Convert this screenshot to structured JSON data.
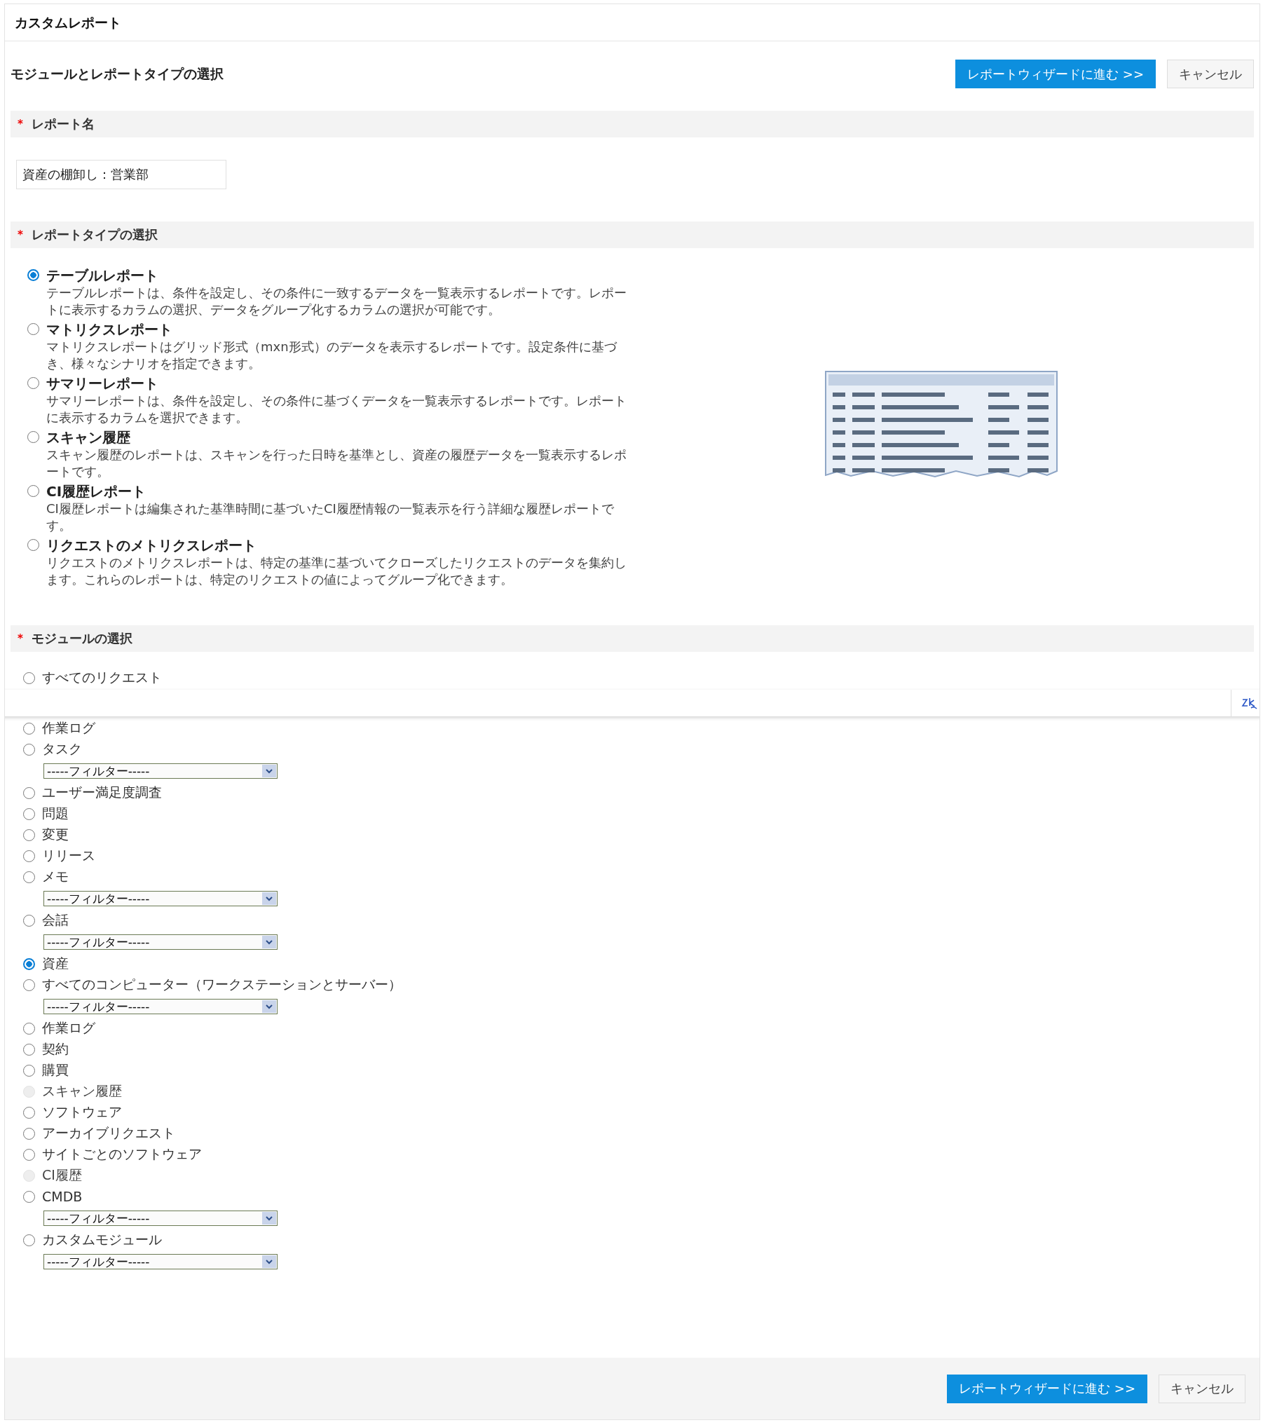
{
  "page_title": "カスタムレポート",
  "heading": "モジュールとレポートタイプの選択",
  "actions": [
    {
      "kind": "primary",
      "label": "レポートウィザードに進む >>"
    },
    {
      "kind": "secondary",
      "label": "キャンセル"
    }
  ],
  "report_name": {
    "label": "レポート名",
    "required_mark": "*",
    "value": "資産の棚卸し：営業部"
  },
  "report_types": {
    "label": "レポートタイプの選択",
    "required_mark": "*",
    "items": [
      {
        "title": "テーブルレポート",
        "description": "テーブルレポートは、条件を設定し、その条件に一致するデータを一覧表示するレポートです。レポートに表示するカラムの選択、データをグループ化するカラムの選択が可能です。",
        "selected": true
      },
      {
        "title": "マトリクスレポート",
        "description": "マトリクスレポートはグリッド形式（mxn形式）のデータを表示するレポートです。設定条件に基づき、様々なシナリオを指定できます。",
        "selected": false
      },
      {
        "title": "サマリーレポート",
        "description": "サマリーレポートは、条件を設定し、その条件に基づくデータを一覧表示するレポートです。レポートに表示するカラムを選択できます。",
        "selected": false
      },
      {
        "title": "スキャン履歴",
        "description": "スキャン履歴のレポートは、スキャンを行った日時を基準とし、資産の履歴データを一覧表示するレポートです。",
        "selected": false
      },
      {
        "title": "CI履歴レポート",
        "description": "CI履歴レポートは編集された基準時間に基づいたCI履歴情報の一覧表示を行う詳細な履歴レポートです。",
        "selected": false
      },
      {
        "title": "リクエストのメトリクスレポート",
        "description": "リクエストのメトリクスレポートは、特定の基準に基づいてクローズしたリクエストのデータを集約します。これらのレポートは、特定のリクエストの値によってグループ化できます。",
        "selected": false
      }
    ]
  },
  "modules": {
    "label": "モジュールの選択",
    "required_mark": "*",
    "items": [
      {
        "label": "すべてのリクエスト",
        "selected": false,
        "disabled": false,
        "kind": "plain"
      },
      {
        "label": "作業ログ",
        "selected": false,
        "disabled": false,
        "kind": "plain"
      },
      {
        "label": "タスク",
        "selected": false,
        "disabled": false,
        "kind": "filtered",
        "filter": "-----フィルター-----"
      },
      {
        "label": "ユーザー満足度調査",
        "selected": false,
        "disabled": false,
        "kind": "plain"
      },
      {
        "label": "問題",
        "selected": false,
        "disabled": false,
        "kind": "plain"
      },
      {
        "label": "変更",
        "selected": false,
        "disabled": false,
        "kind": "plain"
      },
      {
        "label": "リリース",
        "selected": false,
        "disabled": false,
        "kind": "plain"
      },
      {
        "label": "メモ",
        "selected": false,
        "disabled": false,
        "kind": "filtered",
        "filter": "-----フィルター-----"
      },
      {
        "label": "会話",
        "selected": false,
        "disabled": false,
        "kind": "filtered",
        "filter": "-----フィルター-----"
      },
      {
        "label": "資産",
        "selected": true,
        "disabled": false,
        "kind": "plain"
      },
      {
        "label": "すべてのコンピューター（ワークステーションとサーバー）",
        "selected": false,
        "disabled": false,
        "kind": "filtered",
        "filter": "-----フィルター-----"
      },
      {
        "label": "作業ログ",
        "selected": false,
        "disabled": false,
        "kind": "plain"
      },
      {
        "label": "契約",
        "selected": false,
        "disabled": false,
        "kind": "plain"
      },
      {
        "label": "購買",
        "selected": false,
        "disabled": false,
        "kind": "plain"
      },
      {
        "label": "スキャン履歴",
        "selected": false,
        "disabled": true,
        "kind": "plain"
      },
      {
        "label": "ソフトウェア",
        "selected": false,
        "disabled": false,
        "kind": "plain"
      },
      {
        "label": "アーカイブリクエスト",
        "selected": false,
        "disabled": false,
        "kind": "plain"
      },
      {
        "label": "サイトごとのソフトウェア",
        "selected": false,
        "disabled": false,
        "kind": "plain"
      },
      {
        "label": "CI履歴",
        "selected": false,
        "disabled": true,
        "kind": "plain"
      },
      {
        "label": "CMDB",
        "selected": false,
        "disabled": false,
        "kind": "filtered",
        "filter": "-----フィルター-----"
      },
      {
        "label": "カスタムモジュール",
        "selected": false,
        "disabled": false,
        "kind": "filtered",
        "filter": "-----フィルター-----"
      }
    ]
  },
  "overlay_bar": {
    "kind": "floating"
  },
  "footer_actions": [
    {
      "kind": "primary",
      "label": "レポートウィザードに進む >>"
    },
    {
      "kind": "secondary",
      "label": "キャンセル"
    }
  ]
}
